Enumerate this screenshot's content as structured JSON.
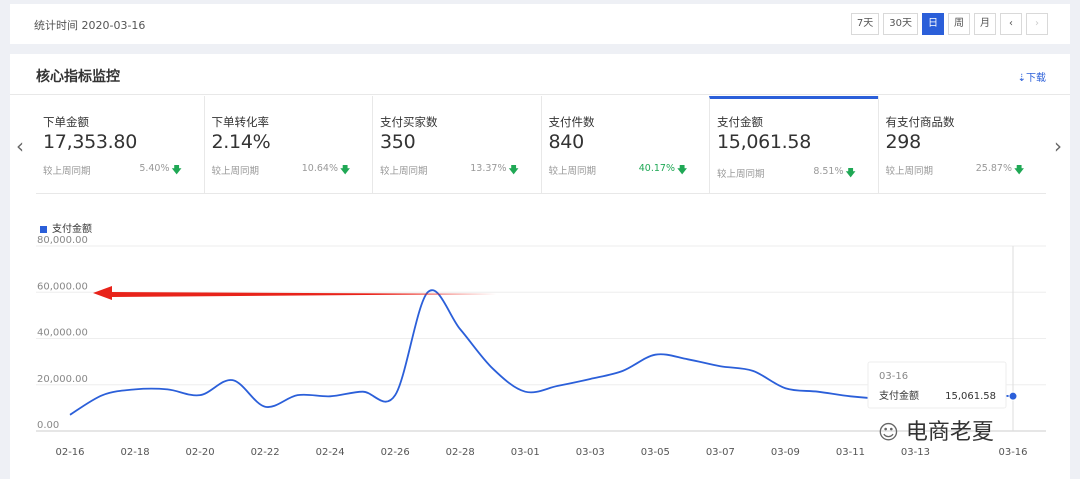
{
  "header": {
    "stat_date": "统计时间 2020-03-16",
    "range_buttons": [
      "7天",
      "30天",
      "日",
      "周",
      "月"
    ],
    "prev": "‹",
    "next": "›"
  },
  "panel": {
    "title": "核心指标监控",
    "download": "⇣下载",
    "left_arrow": "‹",
    "right_arrow": "›"
  },
  "cards": [
    {
      "label": "下单金额",
      "value": "17,353.80",
      "compare": "较上周同期",
      "pct": "5.40%"
    },
    {
      "label": "下单转化率",
      "value": "2.14%",
      "compare": "较上周同期",
      "pct": "10.64%"
    },
    {
      "label": "支付买家数",
      "value": "350",
      "compare": "较上周同期",
      "pct": "13.37%"
    },
    {
      "label": "支付件数",
      "value": "840",
      "compare": "较上周同期",
      "pct": "40.17%"
    },
    {
      "label": "支付金额",
      "value": "15,061.58",
      "compare": "较上周同期",
      "pct": "8.51%"
    },
    {
      "label": "有支付商品数",
      "value": "298",
      "compare": "较上周同期",
      "pct": "25.87%"
    }
  ],
  "colors": {
    "accent": "#2b5fd9",
    "down": "#1fa855",
    "arrow": "#e8231a"
  },
  "chart_data": {
    "type": "line",
    "legend": "支付金额",
    "yticks": [
      "80,000.00",
      "60,000.00",
      "40,000.00",
      "20,000.00",
      "0.00"
    ],
    "ylim": [
      0,
      80000
    ],
    "xtick_labels": [
      "02-16",
      "02-18",
      "02-20",
      "02-22",
      "02-24",
      "02-26",
      "02-28",
      "03-01",
      "03-03",
      "03-05",
      "03-07",
      "03-09",
      "03-11",
      "03-13",
      "03-16"
    ],
    "x": [
      "02-16",
      "02-17",
      "02-18",
      "02-19",
      "02-20",
      "02-21",
      "02-22",
      "02-23",
      "02-24",
      "02-25",
      "02-26",
      "02-27",
      "02-28",
      "02-29",
      "03-01",
      "03-02",
      "03-03",
      "03-04",
      "03-05",
      "03-06",
      "03-07",
      "03-08",
      "03-09",
      "03-10",
      "03-11",
      "03-12",
      "03-13",
      "03-14",
      "03-15",
      "03-16"
    ],
    "values": [
      7000,
      15500,
      18000,
      18000,
      15500,
      22000,
      10500,
      15500,
      15000,
      17000,
      15500,
      60000,
      44000,
      27000,
      17000,
      19500,
      22500,
      26000,
      33000,
      31000,
      28000,
      26000,
      18500,
      17000,
      15000,
      14000,
      14500,
      15000,
      15500,
      15061.58
    ],
    "tooltip": {
      "date": "03-16",
      "label": "支付金额",
      "value": "15,061.58"
    }
  },
  "watermark": "电商老夏"
}
